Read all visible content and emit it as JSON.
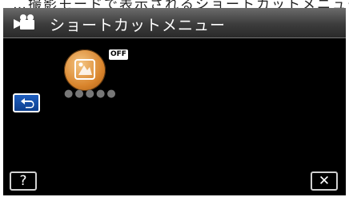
{
  "caption": "…撮影モードで表示されるショートカットメニュー",
  "header": {
    "mode_icon": "video-camera-icon",
    "title": "ショートカットメニュー"
  },
  "shortcut_item": {
    "icon": "scene-select-icon",
    "status_badge": "OFF",
    "label": "●●●●●"
  },
  "buttons": {
    "back_icon": "return-arrow-icon",
    "help_label": "?",
    "close_label": "✕"
  },
  "colors": {
    "accent_orange": "#d9842c",
    "back_button_blue": "#1f5fbf",
    "screen_background": "#000000"
  }
}
